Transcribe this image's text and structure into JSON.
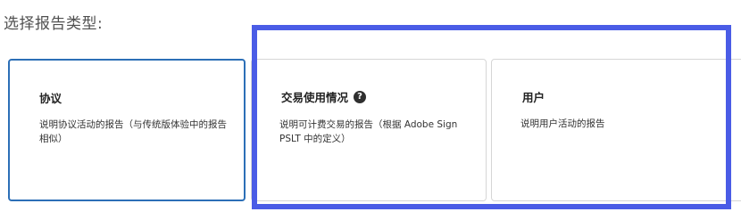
{
  "prompt": "选择报告类型:",
  "cards": {
    "agreement": {
      "title": "协议",
      "description": "说明协议活动的报告（与传统版体验中的报告相似）"
    },
    "transaction": {
      "title": "交易使用情况",
      "help_icon": "question-circle-icon",
      "help_glyph": "?",
      "description": "说明可计费交易的报告（根据 Adobe Sign PSLT 中的定义）"
    },
    "user": {
      "title": "用户",
      "description": "说明用户活动的报告"
    }
  },
  "colors": {
    "selected_border": "#2c6fb7",
    "highlight_annotation": "#4a5ce6",
    "card_border": "#d6d6d6"
  }
}
